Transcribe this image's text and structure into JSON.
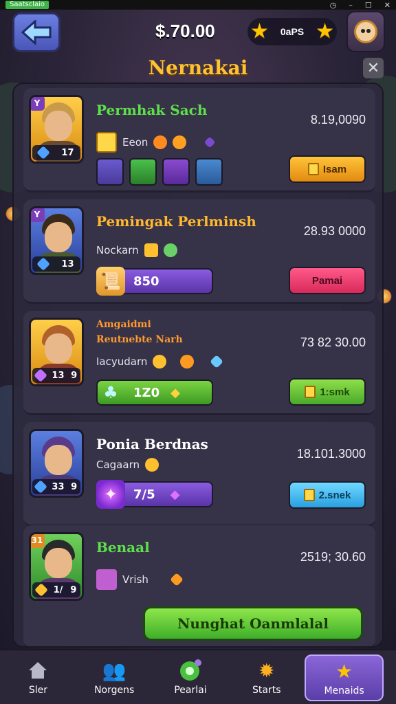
{
  "status_bar": {
    "app_label": "Saatsclaio"
  },
  "header": {
    "coins": "$.70.00",
    "currency_value": "0aPS",
    "title": "Nernakai"
  },
  "rows": [
    {
      "name": "Permhak Sach",
      "name_color": "#5ee04a",
      "subtitle": "Eeon",
      "score": "8.19,0090",
      "rank": "Y",
      "level": "17",
      "portrait": "gold",
      "action": "Isam",
      "action_style": "orange"
    },
    {
      "name": "Pemingak Perlminsh",
      "name_color": "#ffb830",
      "subtitle": "Nockarn",
      "score": "28.93 0000",
      "rank": "Y",
      "level": "13",
      "portrait": "blue",
      "progress": "850",
      "progress_style": "purple",
      "action": "Pamai",
      "action_style": "pink"
    },
    {
      "name": "Amgaidmi",
      "name2": "Reutnebte Narh",
      "name_color": "#ff9a30",
      "subtitle": "Iacyudarn",
      "score": "73 82 30.00",
      "level": "13",
      "level2": "9",
      "portrait": "gold",
      "progress": "1Z0",
      "progress_style": "green",
      "action": "1:smk",
      "action_style": "green"
    },
    {
      "name": "Ponia Berdnas",
      "name_color": "#ffffff",
      "subtitle": "Cagaarn",
      "score": "18.101.3000",
      "level": "33",
      "level2": "9",
      "portrait": "blue",
      "progress": "7/5",
      "progress_style": "purple",
      "action": "2.snek",
      "action_style": "cyan"
    },
    {
      "name": "Benaal",
      "name_color": "#5ee04a",
      "subtitle": "Vrish",
      "score": "2519; 30.60",
      "rank": "31",
      "level": "1/",
      "level2": "9",
      "portrait": "blue"
    }
  ],
  "big_button": "Nunghat Oanmlalal",
  "nav": [
    {
      "label": "Sler",
      "icon": "house-icon"
    },
    {
      "label": "Norgens",
      "icon": "people-icon"
    },
    {
      "label": "Pearlai",
      "icon": "green-orb-icon"
    },
    {
      "label": "Starts",
      "icon": "star-cluster-icon"
    },
    {
      "label": "Menaids",
      "icon": "star-icon",
      "active": true
    }
  ]
}
